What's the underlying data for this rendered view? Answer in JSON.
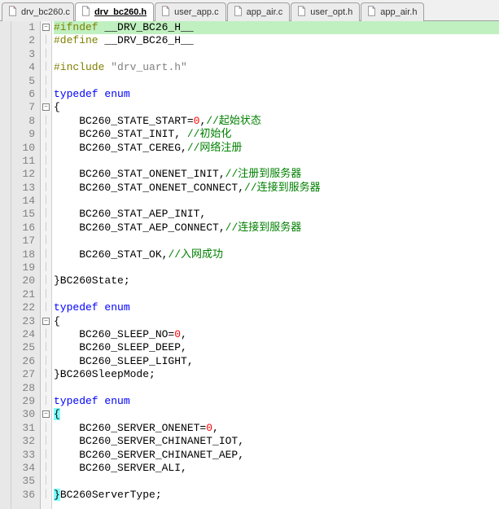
{
  "tabs": [
    {
      "label": "drv_bc260.c",
      "icon": "c",
      "active": false
    },
    {
      "label": "drv_bc260.h",
      "icon": "h",
      "active": true
    },
    {
      "label": "user_app.c",
      "icon": "c",
      "active": false
    },
    {
      "label": "app_air.c",
      "icon": "c",
      "active": false
    },
    {
      "label": "user_opt.h",
      "icon": "h",
      "active": false
    },
    {
      "label": "app_air.h",
      "icon": "h",
      "active": false
    }
  ],
  "code": {
    "lines": [
      {
        "n": 1,
        "fold": "start",
        "hl": "green",
        "tokens": [
          [
            "pre",
            "#ifndef"
          ],
          [
            "txt",
            " __DRV_BC26_H__"
          ]
        ]
      },
      {
        "n": 2,
        "tokens": [
          [
            "pre",
            "#define"
          ],
          [
            "txt",
            " __DRV_BC26_H__"
          ]
        ]
      },
      {
        "n": 3,
        "tokens": []
      },
      {
        "n": 4,
        "tokens": [
          [
            "pre",
            "#include"
          ],
          [
            "txt",
            " "
          ],
          [
            "str",
            "\"drv_uart.h\""
          ]
        ]
      },
      {
        "n": 5,
        "tokens": []
      },
      {
        "n": 6,
        "tokens": [
          [
            "kw",
            "typedef"
          ],
          [
            "txt",
            " "
          ],
          [
            "kw",
            "enum"
          ]
        ]
      },
      {
        "n": 7,
        "fold": "start",
        "tokens": [
          [
            "txt",
            "{"
          ]
        ]
      },
      {
        "n": 8,
        "tokens": [
          [
            "txt",
            "    BC260_STATE_START="
          ],
          [
            "num",
            "0"
          ],
          [
            "txt",
            ","
          ],
          [
            "cmt",
            "//起始状态"
          ]
        ]
      },
      {
        "n": 9,
        "tokens": [
          [
            "txt",
            "    BC260_STAT_INIT, "
          ],
          [
            "cmt",
            "//初始化"
          ]
        ]
      },
      {
        "n": 10,
        "tokens": [
          [
            "txt",
            "    BC260_STAT_CEREG,"
          ],
          [
            "cmt",
            "//网络注册"
          ]
        ]
      },
      {
        "n": 11,
        "tokens": []
      },
      {
        "n": 12,
        "tokens": [
          [
            "txt",
            "    BC260_STAT_ONENET_INIT,"
          ],
          [
            "cmt",
            "//注册到服务器"
          ]
        ]
      },
      {
        "n": 13,
        "tokens": [
          [
            "txt",
            "    BC260_STAT_ONENET_CONNECT,"
          ],
          [
            "cmt",
            "//连接到服务器"
          ]
        ]
      },
      {
        "n": 14,
        "tokens": []
      },
      {
        "n": 15,
        "tokens": [
          [
            "txt",
            "    BC260_STAT_AEP_INIT,"
          ]
        ]
      },
      {
        "n": 16,
        "tokens": [
          [
            "txt",
            "    BC260_STAT_AEP_CONNECT,"
          ],
          [
            "cmt",
            "//连接到服务器"
          ]
        ]
      },
      {
        "n": 17,
        "tokens": []
      },
      {
        "n": 18,
        "tokens": [
          [
            "txt",
            "    BC260_STAT_OK,"
          ],
          [
            "cmt",
            "//入网成功"
          ]
        ]
      },
      {
        "n": 19,
        "tokens": []
      },
      {
        "n": 20,
        "tokens": [
          [
            "txt",
            "}BC260State;"
          ]
        ]
      },
      {
        "n": 21,
        "tokens": []
      },
      {
        "n": 22,
        "tokens": [
          [
            "kw",
            "typedef"
          ],
          [
            "txt",
            " "
          ],
          [
            "kw",
            "enum"
          ]
        ]
      },
      {
        "n": 23,
        "fold": "start",
        "tokens": [
          [
            "txt",
            "{"
          ]
        ]
      },
      {
        "n": 24,
        "tokens": [
          [
            "txt",
            "    BC260_SLEEP_NO="
          ],
          [
            "num",
            "0"
          ],
          [
            "txt",
            ","
          ]
        ]
      },
      {
        "n": 25,
        "tokens": [
          [
            "txt",
            "    BC260_SLEEP_DEEP,"
          ]
        ]
      },
      {
        "n": 26,
        "tokens": [
          [
            "txt",
            "    BC260_SLEEP_LIGHT,"
          ]
        ]
      },
      {
        "n": 27,
        "tokens": [
          [
            "txt",
            "}BC260SleepMode;"
          ]
        ]
      },
      {
        "n": 28,
        "tokens": []
      },
      {
        "n": 29,
        "tokens": [
          [
            "kw",
            "typedef"
          ],
          [
            "txt",
            " "
          ],
          [
            "kw",
            "enum"
          ]
        ]
      },
      {
        "n": 30,
        "fold": "start",
        "hl": "cyan-brace",
        "tokens": [
          [
            "txt",
            "{"
          ]
        ]
      },
      {
        "n": 31,
        "tokens": [
          [
            "txt",
            "    BC260_SERVER_ONENET="
          ],
          [
            "num",
            "0"
          ],
          [
            "txt",
            ","
          ]
        ]
      },
      {
        "n": 32,
        "tokens": [
          [
            "txt",
            "    BC260_SERVER_CHINANET_IOT,"
          ]
        ]
      },
      {
        "n": 33,
        "tokens": [
          [
            "txt",
            "    BC260_SERVER_CHINANET_AEP,"
          ]
        ]
      },
      {
        "n": 34,
        "tokens": [
          [
            "txt",
            "    BC260_SERVER_ALI,"
          ]
        ]
      },
      {
        "n": 35,
        "tokens": []
      },
      {
        "n": 36,
        "hl": "cyan-brace",
        "tokens": [
          [
            "txt",
            "}"
          ],
          [
            "plain",
            "BC260ServerType;"
          ]
        ]
      }
    ]
  }
}
